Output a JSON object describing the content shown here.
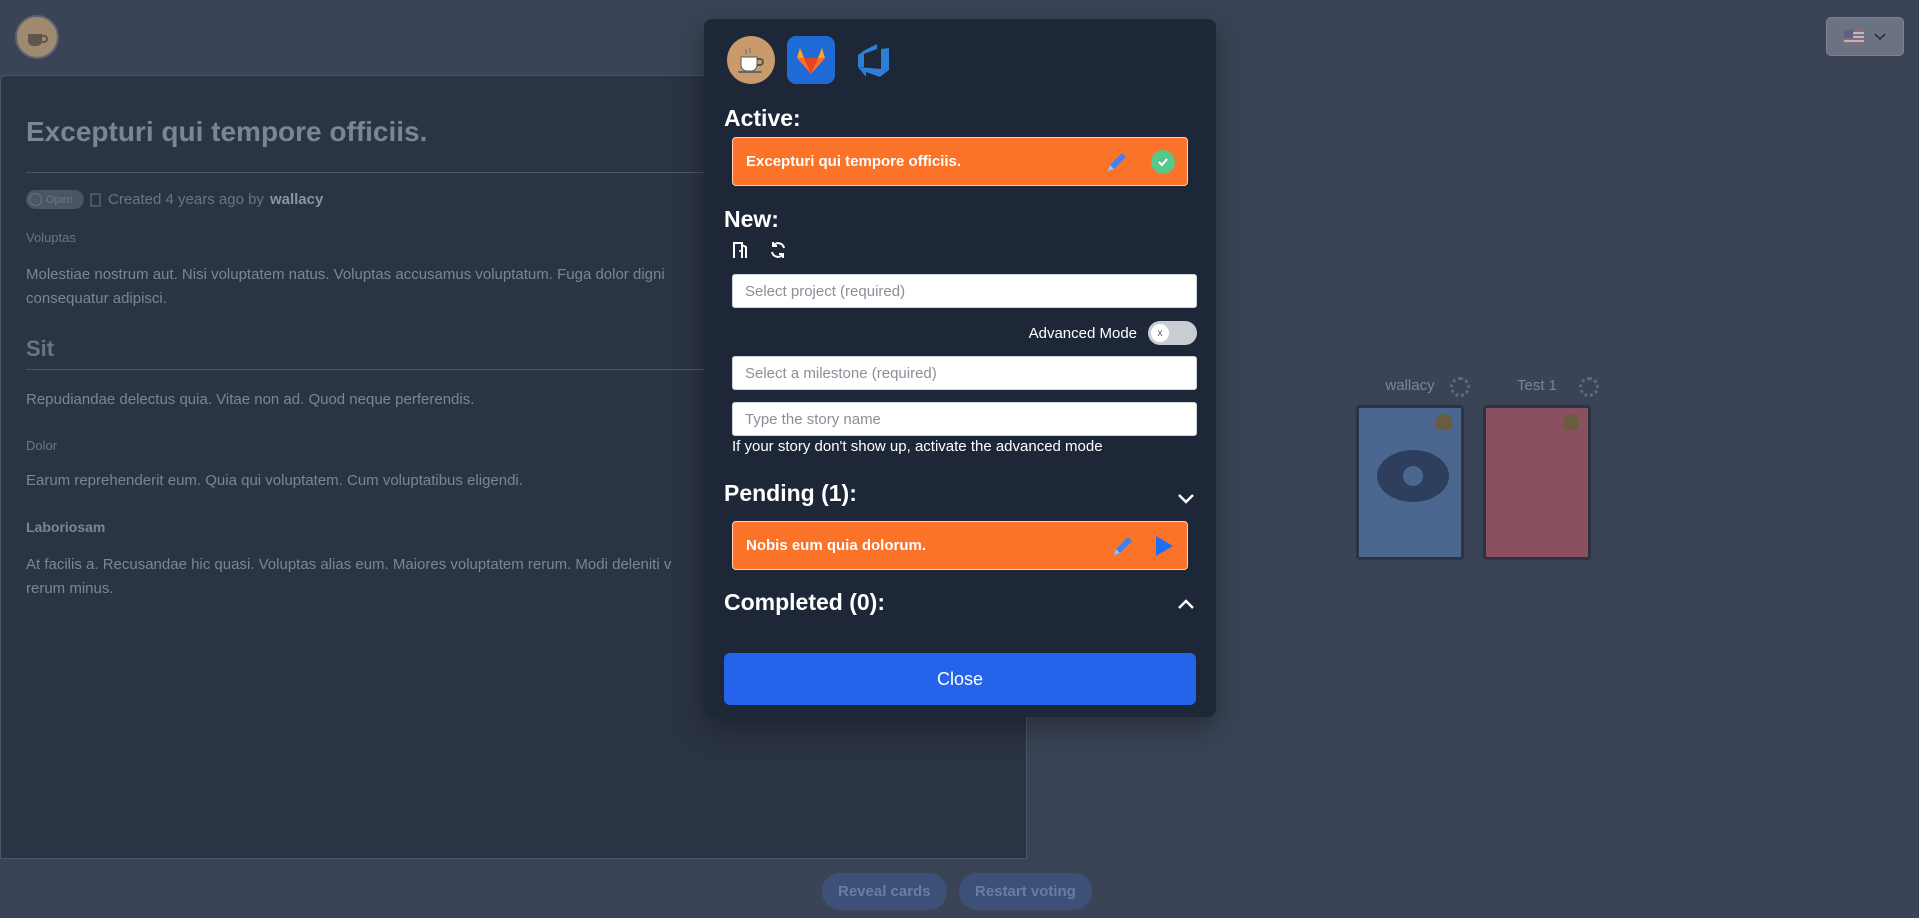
{
  "background": {
    "story": {
      "title": "Excepturi qui tempore officiis.",
      "status": "Open",
      "created_text": "Created 4 years ago by",
      "author": "wallacy",
      "voluptas_label": "Voluptas",
      "voluptas_text": "Molestiae nostrum aut. Nisi voluptatem natus. Voluptas accusamus voluptatum. Fuga dolor digni",
      "voluptas_text_2": "consequatur adipisci.",
      "sit_heading": "Sit",
      "sit_text": "Repudiandae delectus quia. Vitae non ad. Quod neque perferendis.",
      "dolor_label": "Dolor",
      "dolor_text": "Earum reprehenderit eum. Quia qui voluptatem. Cum voluptatibus eligendi.",
      "laboriosam_heading": "Laboriosam",
      "laboriosam_text": "At facilis a. Recusandae hic quasi. Voluptas alias eum. Maiores voluptatem rerum. Modi deleniti v",
      "laboriosam_text_2": "rerum minus."
    },
    "players": [
      {
        "name": "wallacy",
        "card_color": "#4b6790",
        "revealed_icon": "eye-icon"
      },
      {
        "name": "Test 1",
        "card_color": "#8a5060"
      }
    ],
    "bottom": {
      "reveal": "Reveal cards",
      "restart": "Restart voting"
    },
    "language": "flag-us-icon"
  },
  "modal": {
    "providers": [
      "coffee-cup-icon",
      "gitlab-icon",
      "azure-devops-icon"
    ],
    "active_title": "Active:",
    "active_story": "Excepturi qui tempore officiis.",
    "new_title": "New:",
    "project_placeholder": "Select project (required)",
    "advanced_label": "Advanced Mode",
    "advanced_toggle": "x",
    "milestone_placeholder": "Select a milestone (required)",
    "story_placeholder": "Type the story name",
    "hint": "If your story don't show up, activate the advanced mode",
    "pending_title": "Pending (1):",
    "pending_story": "Nobis eum quia dolorum.",
    "completed_title": "Completed (0):",
    "close_label": "Close"
  },
  "colors": {
    "accent": "#2563eb",
    "story_item": "#fb7229",
    "check": "#58c88a",
    "modal_bg": "#1e2737"
  }
}
